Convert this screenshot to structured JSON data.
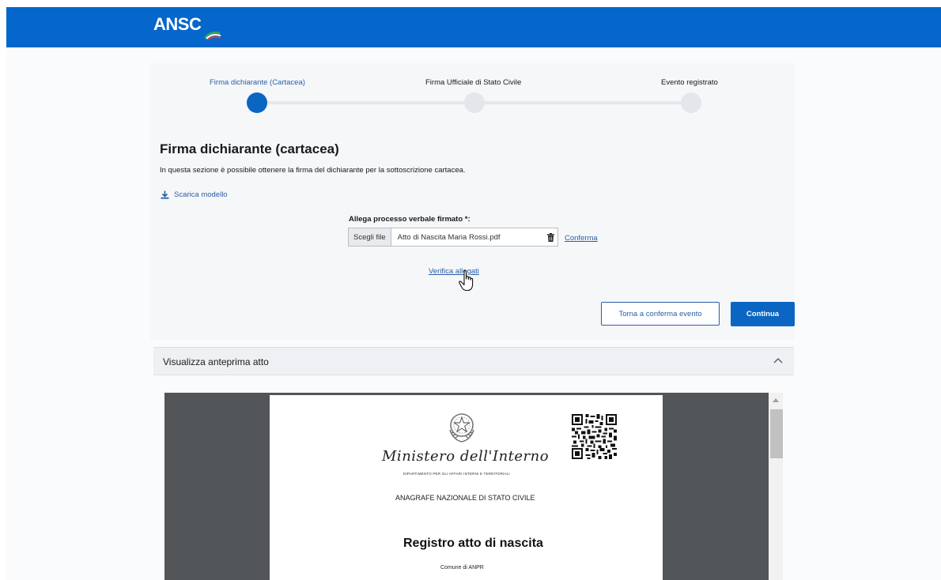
{
  "header": {
    "logo_text": "ANSC",
    "brand_color": "#0566cb"
  },
  "stepper": {
    "steps": [
      {
        "label": "Firma dichiarante (Cartacea)",
        "state": "active"
      },
      {
        "label": "Firma Ufficiale di Stato Civile",
        "state": "pending"
      },
      {
        "label": "Evento registrato",
        "state": "pending"
      }
    ]
  },
  "section": {
    "title": "Firma dichiarante (cartacea)",
    "description": "In questa sezione è possibile ottenere la firma del dichiarante per la sottoscrizione cartacea.",
    "download_label": "Scarica modello"
  },
  "upload": {
    "label": "Allega processo verbale firmato *:",
    "choose_button": "Scegli file",
    "file_name": "Atto di Nascita Maria Rossi.pdf",
    "confirm_link": "Conferma",
    "verify_link": "Verifica allegati"
  },
  "actions": {
    "back_button": "Torna a conferma evento",
    "continue_button": "Continua"
  },
  "preview": {
    "accordion_title": "Visualizza anteprima atto",
    "document": {
      "ministry": "Ministero dell'Interno",
      "department": "DIPARTIMENTO PER GLI AFFARI INTERNI E TERRITORIALI",
      "registry": "ANAGRAFE NAZIONALE DI STATO CIVILE",
      "title": "Registro atto di nascita",
      "subtitle": "Comune di ANPR"
    }
  },
  "colors": {
    "accent": "#0a66c2",
    "link": "#2a5ea6"
  }
}
